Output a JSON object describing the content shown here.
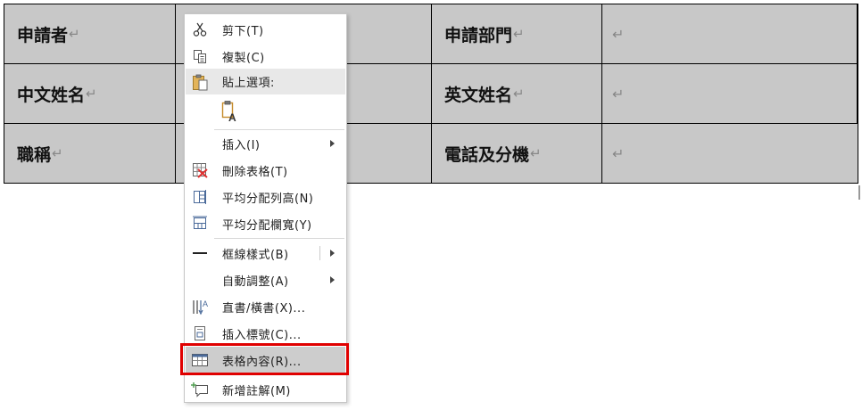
{
  "table": {
    "return_mark": "↵",
    "rows": [
      {
        "label1": "申請者",
        "label2": "申請部門"
      },
      {
        "label1": "中文姓名",
        "label2": "英文姓名"
      },
      {
        "label1": "職稱",
        "label2": "電話及分機"
      }
    ],
    "cell_color": "#c8c8c8"
  },
  "menu": {
    "cut": "剪下(T)",
    "copy": "複製(C)",
    "paste_options": "貼上選項:",
    "paste_icon": "paste-keep-text-only-icon",
    "insert": "插入(I)",
    "delete_table": "刪除表格(T)",
    "distribute_rows": "平均分配列高(N)",
    "distribute_cols": "平均分配欄寬(Y)",
    "border_styles": "框線樣式(B)",
    "autofit": "自動調整(A)",
    "text_direction": "直書/橫書(X)...",
    "insert_caption": "插入標號(C)...",
    "table_properties": "表格內容(R)...",
    "new_comment": "新增註解(M)"
  },
  "colors": {
    "highlight_border": "#e00000",
    "menu_hover": "#cdcdcd"
  }
}
